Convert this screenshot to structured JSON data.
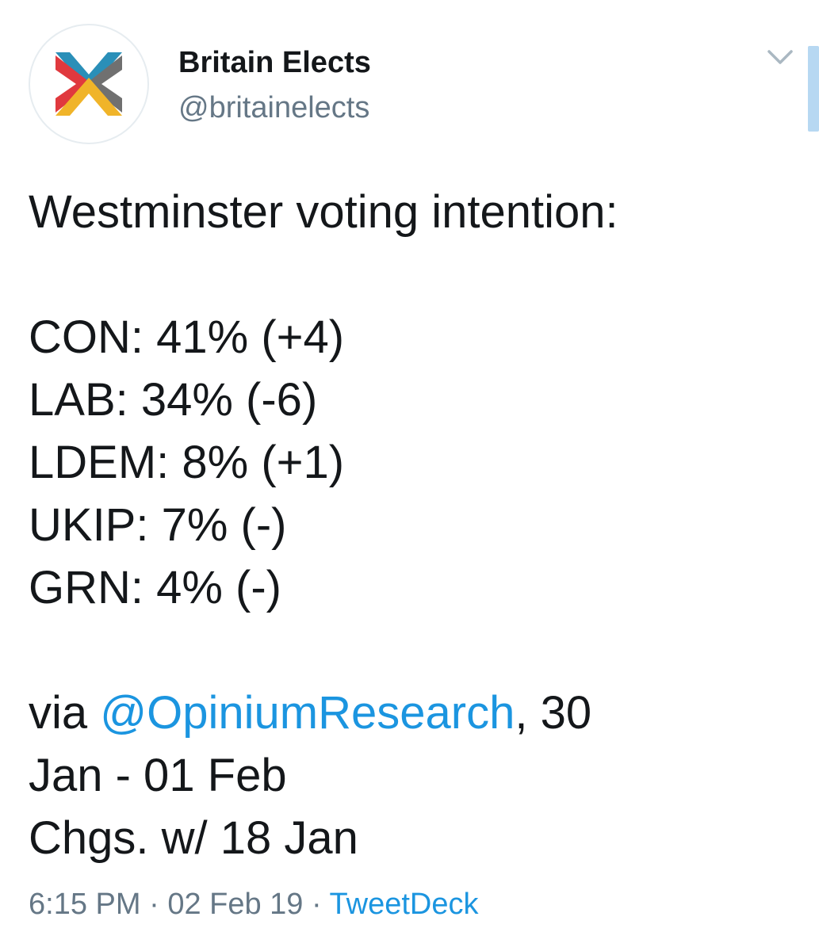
{
  "author": {
    "name": "Britain Elects",
    "handle": "@britainelects"
  },
  "tweet": {
    "heading": "Westminster voting intention:",
    "results": [
      "CON: 41% (+4)",
      "LAB: 34% (-6)",
      "LDEM: 8% (+1)",
      "UKIP: 7% (-)",
      "GRN: 4% (-)"
    ],
    "via_prefix": "via ",
    "mention": "@OpiniumResearch",
    "via_suffix": ", 30",
    "dates": "Jan - 01 Feb",
    "changes": "Chgs. w/ 18 Jan"
  },
  "meta": {
    "time": "6:15 PM",
    "separator": " · ",
    "date": "02 Feb 19",
    "source": "TweetDeck"
  },
  "icons": {
    "avatar": "britain-elects-logo-icon",
    "menu": "chevron-down-icon"
  },
  "colors": {
    "link": "#1b95e0",
    "secondary_text": "#657786",
    "logo_blue": "#2a8fb8",
    "logo_red": "#e0393e",
    "logo_gold": "#f0b429",
    "logo_grey": "#707070"
  }
}
